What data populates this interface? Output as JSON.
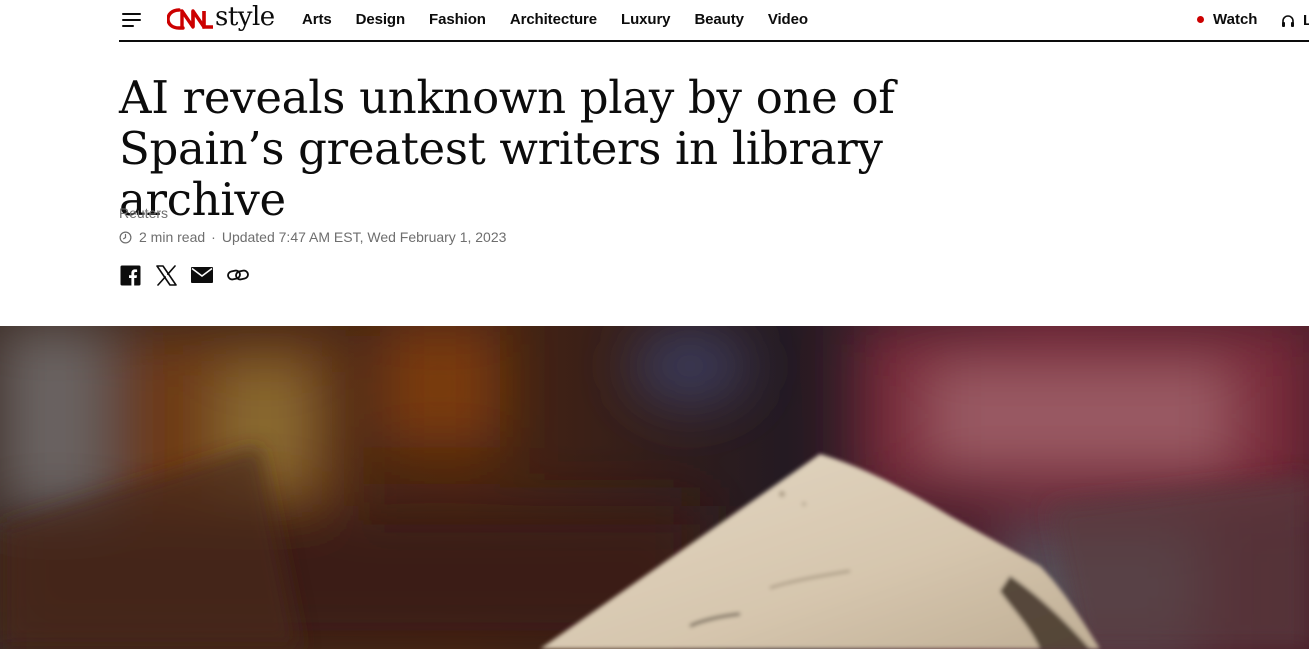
{
  "header": {
    "brand_suffix": "style",
    "nav": [
      "Arts",
      "Design",
      "Fashion",
      "Architecture",
      "Luxury",
      "Beauty",
      "Video"
    ],
    "watch_label": "Watch",
    "listen_label": "L"
  },
  "article": {
    "headline": "AI reveals unknown play by one of Spain’s greatest writers in library archive",
    "source": "Reuters",
    "read_time": "2 min read",
    "separator": "·",
    "updated": "Updated 7:47 AM EST, Wed February 1, 2023"
  },
  "share": {
    "icons": [
      "facebook-icon",
      "x-icon",
      "email-icon",
      "link-icon"
    ]
  },
  "hero_image": {
    "caption_text_visible": "",
    "colors": {
      "background": "#2a1a12",
      "paper": "#d9cbb5"
    }
  },
  "colors": {
    "accent_red": "#cc0000",
    "text": "#0c0c0c",
    "muted": "#6e6e6e"
  }
}
